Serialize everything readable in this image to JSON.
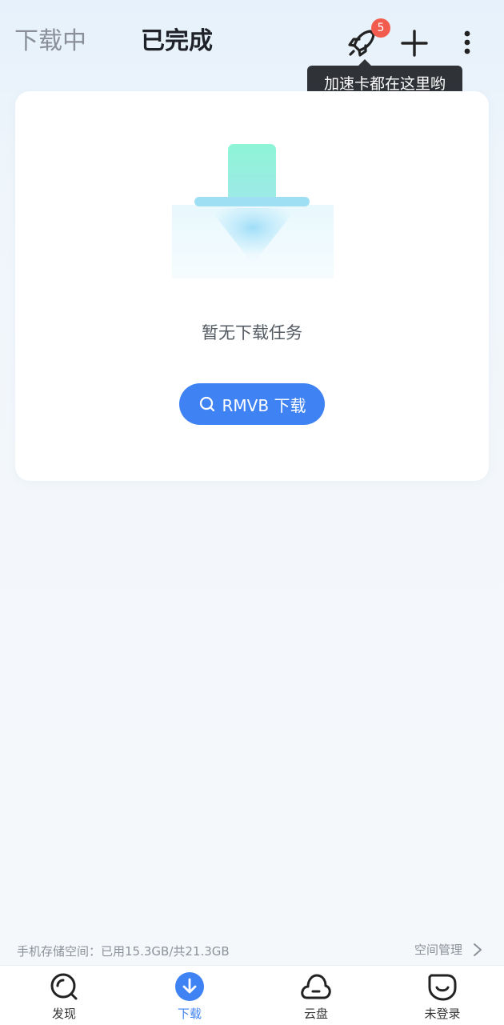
{
  "header": {
    "tabs": [
      {
        "label": "下载中",
        "active": false
      },
      {
        "label": "已完成",
        "active": true
      }
    ],
    "badge_count": "5",
    "tooltip": "加速卡都在这里哟"
  },
  "empty_state": {
    "message": "暂无下载任务",
    "search_button_label": "RMVB 下载"
  },
  "storage": {
    "info": "手机存储空间：已用15.3GB/共21.3GB",
    "manage_label": "空间管理"
  },
  "bottom_nav": {
    "items": [
      {
        "label": "发现",
        "icon": "discover-icon",
        "active": false
      },
      {
        "label": "下载",
        "icon": "download-icon",
        "active": true
      },
      {
        "label": "云盘",
        "icon": "cloud-icon",
        "active": false
      },
      {
        "label": "未登录",
        "icon": "account-icon",
        "active": false
      }
    ]
  },
  "colors": {
    "accent": "#3f82f4",
    "badge": "#f25c4f",
    "tooltip_bg": "#2f3237"
  }
}
